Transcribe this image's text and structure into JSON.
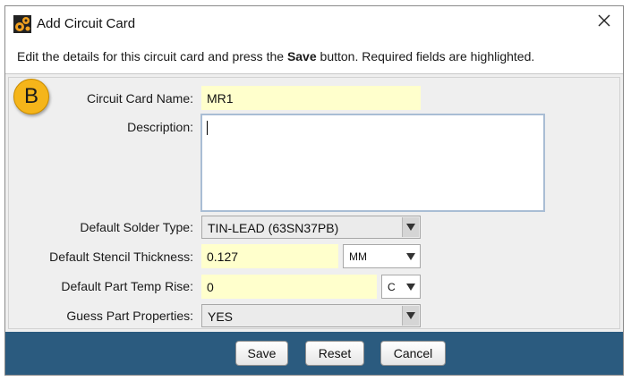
{
  "window": {
    "title": "Add Circuit Card",
    "close_icon": "close-icon",
    "app_icon": "gears-icon"
  },
  "instruction": {
    "prefix": "Edit the details for this circuit card and press the ",
    "bold": "Save",
    "suffix": " button. Required fields are highlighted."
  },
  "badge": {
    "letter": "B",
    "color": "#f5b51a"
  },
  "form": {
    "name_label": "Circuit Card Name:",
    "name_value": "MR1",
    "description_label": "Description:",
    "description_value": "",
    "solder_label": "Default Solder Type:",
    "solder_value": "TIN-LEAD (63SN37PB)",
    "stencil_label": "Default Stencil Thickness:",
    "stencil_value": "0.127",
    "stencil_unit": "MM",
    "temp_label": "Default Part Temp Rise:",
    "temp_value": "0",
    "temp_unit": "C",
    "guess_label": "Guess Part Properties:",
    "guess_value": "YES",
    "required_color": "#ffffcc"
  },
  "buttons": {
    "save": "Save",
    "reset": "Reset",
    "cancel": "Cancel"
  },
  "colors": {
    "footer": "#2b5b7f"
  }
}
